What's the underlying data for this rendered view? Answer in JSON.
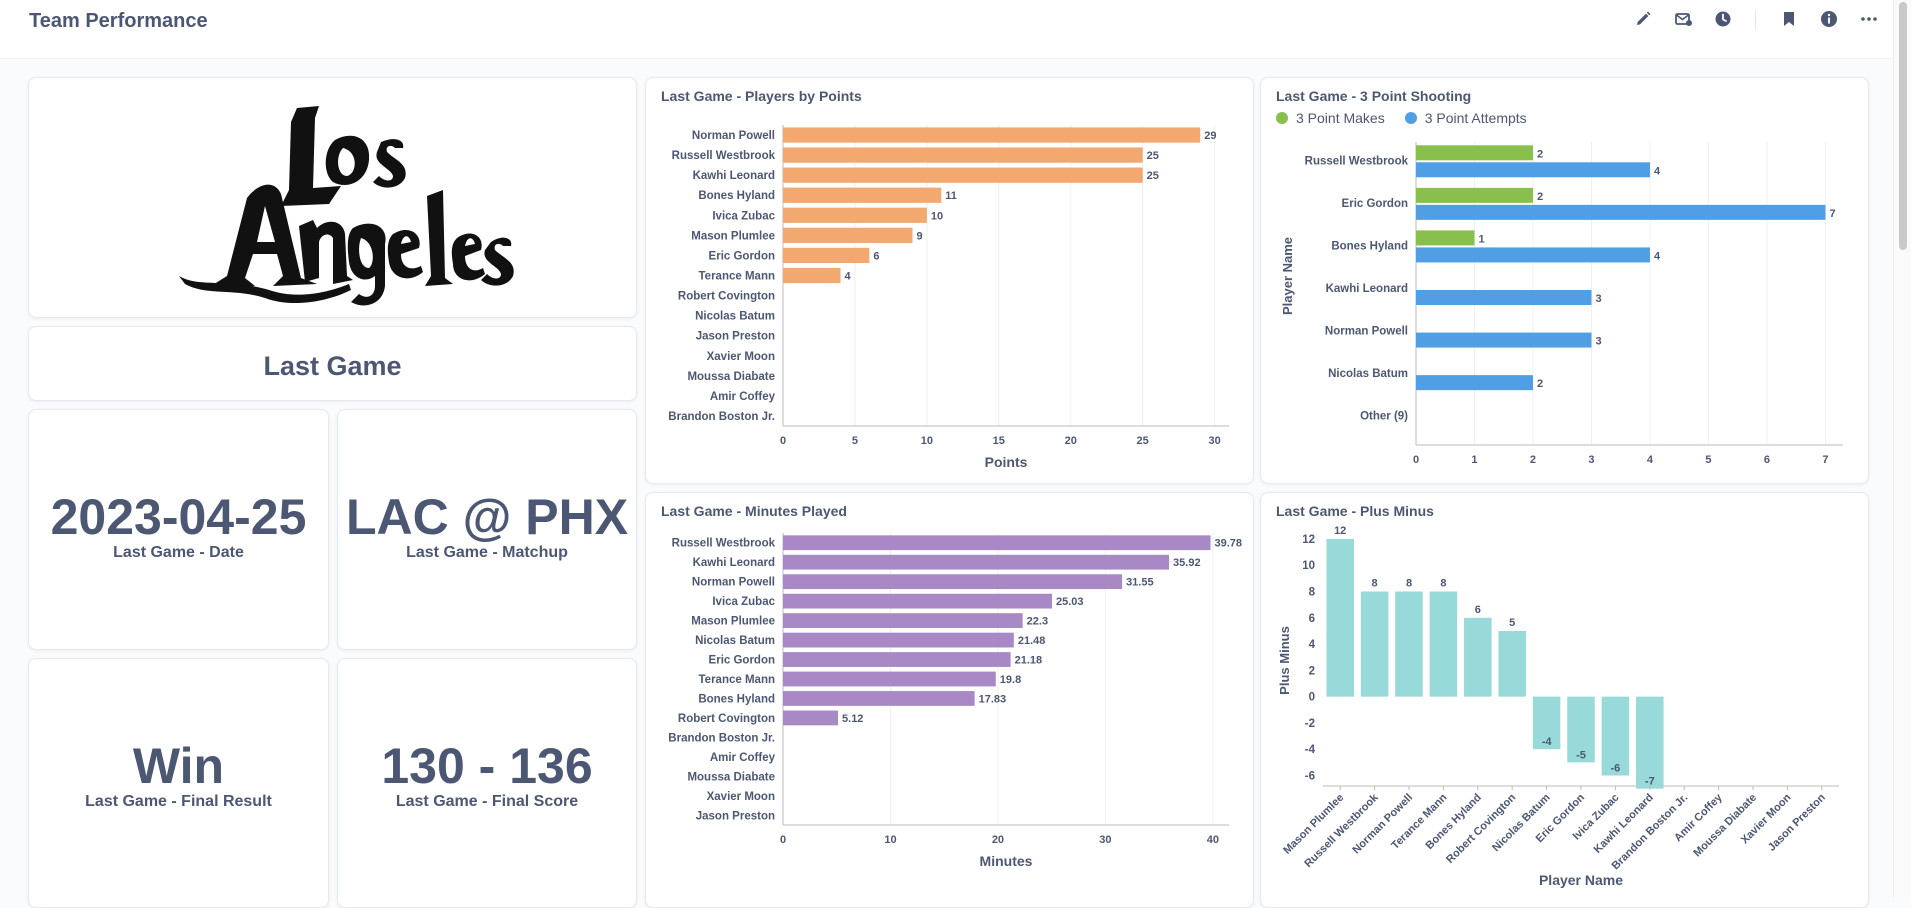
{
  "dashboard": {
    "title": "Team Performance"
  },
  "toolbar": {
    "icons": [
      "pencil-icon",
      "subscriptions-icon",
      "history-icon",
      "bookmark-icon",
      "info-icon",
      "more-icon"
    ]
  },
  "cards": {
    "logo": {
      "logo_text": "Los Angeles"
    },
    "heading": {
      "text": "Last Game"
    },
    "date": {
      "value": "2023-04-25",
      "label": "Last Game - Date"
    },
    "matchup": {
      "value": "LAC @ PHX",
      "label": "Last Game - Matchup"
    },
    "result": {
      "value": "Win",
      "label": "Last Game - Final Result"
    },
    "score": {
      "value": "130 - 136",
      "label": "Last Game - Final Score"
    },
    "points": {
      "title": "Last Game - Players by Points"
    },
    "three": {
      "title": "Last Game - 3 Point Shooting",
      "legend_makes": "3 Point Makes",
      "legend_attempts": "3 Point Attempts"
    },
    "minutes": {
      "title": "Last Game - Minutes Played"
    },
    "plusminus": {
      "title": "Last Game - Plus Minus"
    }
  },
  "colors": {
    "points": "#f2a86f",
    "makes": "#88bf4d",
    "attempts": "#509ee3",
    "minutes": "#a989c5",
    "plusminus": "#98d9d9",
    "text": "#4c5773",
    "grid": "#edf0f3"
  },
  "chart_data": [
    {
      "id": "points",
      "type": "bar",
      "orientation": "horizontal",
      "title": "Last Game - Players by Points",
      "xlabel": "Points",
      "ylabel": "",
      "xlim": [
        0,
        31
      ],
      "ticks": [
        0,
        5,
        10,
        15,
        20,
        25,
        30
      ],
      "categories": [
        "Norman Powell",
        "Russell Westbrook",
        "Kawhi Leonard",
        "Bones Hyland",
        "Ivica Zubac",
        "Mason Plumlee",
        "Eric Gordon",
        "Terance Mann",
        "Robert Covington",
        "Nicolas Batum",
        "Jason Preston",
        "Xavier Moon",
        "Moussa Diabate",
        "Amir Coffey",
        "Brandon Boston Jr."
      ],
      "values": [
        29,
        25,
        25,
        11,
        10,
        9,
        6,
        4,
        null,
        null,
        null,
        null,
        null,
        null,
        null
      ]
    },
    {
      "id": "three",
      "type": "bar",
      "orientation": "horizontal",
      "title": "Last Game - 3 Point Shooting",
      "xlabel": "",
      "ylabel": "Player Name",
      "xlim": [
        0,
        7.3
      ],
      "ticks": [
        0,
        1,
        2,
        3,
        4,
        5,
        6,
        7
      ],
      "legend": "top-left",
      "categories": [
        "Russell Westbrook",
        "Eric Gordon",
        "Bones Hyland",
        "Kawhi Leonard",
        "Norman Powell",
        "Nicolas Batum",
        "Other (9)"
      ],
      "series": [
        {
          "name": "3 Point Makes",
          "values": [
            2,
            2,
            1,
            null,
            null,
            null,
            null
          ]
        },
        {
          "name": "3 Point Attempts",
          "values": [
            4,
            7,
            4,
            3,
            3,
            2,
            null
          ]
        }
      ]
    },
    {
      "id": "minutes",
      "type": "bar",
      "orientation": "horizontal",
      "title": "Last Game - Minutes Played",
      "xlabel": "Minutes",
      "ylabel": "",
      "xlim": [
        0,
        41.5
      ],
      "ticks": [
        0,
        10,
        20,
        30,
        40
      ],
      "categories": [
        "Russell Westbrook",
        "Kawhi Leonard",
        "Norman Powell",
        "Ivica Zubac",
        "Mason Plumlee",
        "Nicolas Batum",
        "Eric Gordon",
        "Terance Mann",
        "Bones Hyland",
        "Robert Covington",
        "Brandon Boston Jr.",
        "Amir Coffey",
        "Moussa Diabate",
        "Xavier Moon",
        "Jason Preston"
      ],
      "values": [
        39.78,
        35.92,
        31.55,
        25.03,
        22.3,
        21.48,
        21.18,
        19.8,
        17.83,
        5.12,
        null,
        null,
        null,
        null,
        null
      ],
      "labels": [
        "39.78",
        "35.92",
        "31.55",
        "25.03",
        "22.3",
        "21.48",
        "21.18",
        "19.8",
        "17.83",
        "5.12",
        "",
        "",
        "",
        "",
        ""
      ]
    },
    {
      "id": "plusminus",
      "type": "bar",
      "orientation": "vertical",
      "title": "Last Game - Plus Minus",
      "xlabel": "Player Name",
      "ylabel": "Plus Minus",
      "ylim": [
        -6.8,
        12.3
      ],
      "ticks": [
        12,
        10,
        8,
        6,
        4,
        2,
        0,
        -2,
        -4,
        -6
      ],
      "categories": [
        "Mason Plumlee",
        "Russell Westbrook",
        "Norman Powell",
        "Terance Mann",
        "Bones Hyland",
        "Robert Covington",
        "Nicolas Batum",
        "Eric Gordon",
        "Ivica Zubac",
        "Kawhi Leonard",
        "Brandon Boston Jr.",
        "Amir Coffey",
        "Moussa Diabate",
        "Xavier Moon",
        "Jason Preston"
      ],
      "values": [
        12,
        8,
        8,
        8,
        6,
        5,
        -4,
        -5,
        -6,
        -7,
        null,
        null,
        null,
        null,
        null
      ]
    }
  ]
}
